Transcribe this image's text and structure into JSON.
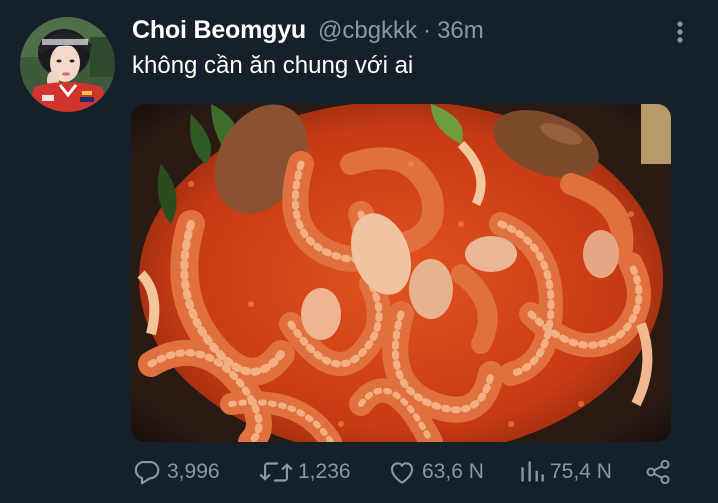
{
  "tweet": {
    "display_name": "Choi Beomgyu",
    "handle": "@cbgkkk",
    "separator": "·",
    "time": "36m",
    "text": "không cần ăn chung với ai",
    "avatar_icon": "profile-photo",
    "media_alt_icon": "spicy-octopus-stew-photo",
    "more_icon": "vertical-ellipsis-icon"
  },
  "actions": {
    "reply": {
      "icon": "reply-bubble-icon",
      "count": "3,996"
    },
    "retweet": {
      "icon": "retweet-arrows-icon",
      "count": "1,236"
    },
    "like": {
      "icon": "heart-icon",
      "count": "63,6 N"
    },
    "views": {
      "icon": "analytics-bars-icon",
      "count": "75,4 N"
    },
    "share": {
      "icon": "share-nodes-icon"
    }
  },
  "colors": {
    "background": "#15202b",
    "primary_text": "#ffffff",
    "secondary_text": "#8899a6"
  }
}
